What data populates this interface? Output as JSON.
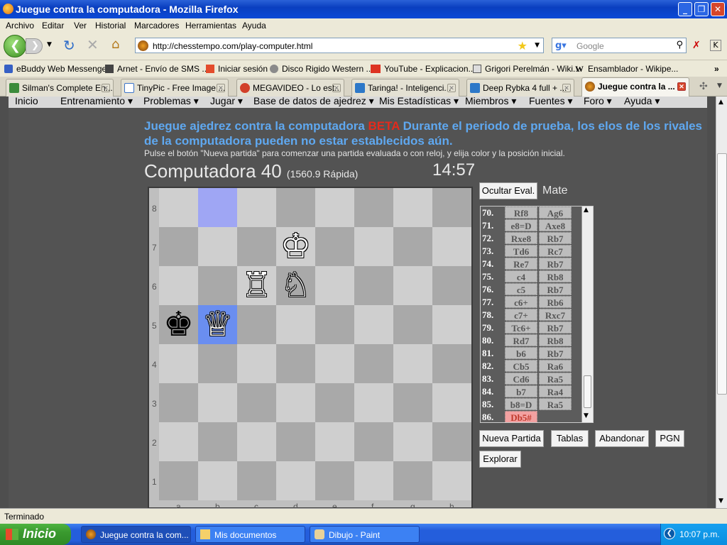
{
  "window": {
    "title": "Juegue contra la computadora - Mozilla Firefox"
  },
  "menu": [
    "Archivo",
    "Editar",
    "Ver",
    "Historial",
    "Marcadores",
    "Herramientas",
    "Ayuda"
  ],
  "nav": {
    "url": "http://chesstempo.com/play-computer.html",
    "search_placeholder": "Google"
  },
  "bookmarks": [
    "eBuddy Web Messenger",
    "Arnet - Envío de SMS ...",
    "Iniciar sesión",
    "Disco Rigido Western ...",
    "YouTube - Explicacion...",
    "Grigori Perelmán - Wiki...",
    "Ensamblador - Wikipe..."
  ],
  "tabs": [
    {
      "label": "Silman's Complete En...",
      "active": false
    },
    {
      "label": "TinyPic - Free Image ...",
      "active": false
    },
    {
      "label": "MEGAVIDEO - Lo est...",
      "active": false
    },
    {
      "label": "Taringa! - Inteligenci...",
      "active": false
    },
    {
      "label": "Deep Rybka 4 full + ...",
      "active": false
    },
    {
      "label": "Juegue contra la ...",
      "active": true
    }
  ],
  "sitenav": [
    "Inicio",
    "Entrenamiento ▾",
    "Problemas ▾",
    "Jugar ▾",
    "Base de datos de ajedrez ▾",
    "Mis Estadísticas ▾",
    "Miembros ▾",
    "Fuentes ▾",
    "Foro ▾",
    "Ayuda ▾"
  ],
  "page": {
    "heading_pre": "Juegue ajedrez contra la computadora ",
    "heading_beta": "BETA",
    "heading_post": " Durante el periodo de prueba, los elos de los rivales",
    "heading_line2": "de la computadora pueden no estar establecidos aún.",
    "subtitle": "Pulse el botón \"Nueva partida\" para comenzar una partida evaluada o con reloj, y elija color y la posición inicial.",
    "opponent_name": "Computadora 40",
    "opponent_rating": "(1560.9 Rápida)",
    "clock": "14:57"
  },
  "board": {
    "ranks": [
      "8",
      "7",
      "6",
      "5",
      "4",
      "3",
      "2",
      "1"
    ],
    "files": [
      "a",
      "b",
      "c",
      "d",
      "e",
      "f",
      "g",
      "h"
    ],
    "highlight_squares": [
      "b8",
      "b5"
    ],
    "pieces": [
      {
        "square": "d7",
        "glyph": "♔",
        "color": "white",
        "name": "white-king"
      },
      {
        "square": "c6",
        "glyph": "♖",
        "color": "white",
        "name": "white-rook"
      },
      {
        "square": "d6",
        "glyph": "♘",
        "color": "white",
        "name": "white-knight"
      },
      {
        "square": "a5",
        "glyph": "♚",
        "color": "black",
        "name": "black-king"
      },
      {
        "square": "b5",
        "glyph": "♕",
        "color": "white",
        "name": "white-queen"
      }
    ]
  },
  "controls": {
    "hide_eval": "Ocultar Eval.",
    "eval_text": "Mate",
    "new_game": "Nueva Partida",
    "draw": "Tablas",
    "resign": "Abandonar",
    "pgn": "PGN",
    "explore": "Explorar"
  },
  "moves": [
    {
      "n": "70.",
      "w": "Rf8",
      "b": "Ag6"
    },
    {
      "n": "71.",
      "w": "e8=D",
      "b": "Axe8"
    },
    {
      "n": "72.",
      "w": "Rxe8",
      "b": "Rb7"
    },
    {
      "n": "73.",
      "w": "Td6",
      "b": "Rc7"
    },
    {
      "n": "74.",
      "w": "Re7",
      "b": "Rb7"
    },
    {
      "n": "75.",
      "w": "c4",
      "b": "Rb8"
    },
    {
      "n": "76.",
      "w": "c5",
      "b": "Rb7"
    },
    {
      "n": "77.",
      "w": "c6+",
      "b": "Rb6"
    },
    {
      "n": "78.",
      "w": "c7+",
      "b": "Rxc7"
    },
    {
      "n": "79.",
      "w": "Tc6+",
      "b": "Rb7"
    },
    {
      "n": "80.",
      "w": "Rd7",
      "b": "Rb8"
    },
    {
      "n": "81.",
      "w": "b6",
      "b": "Rb7"
    },
    {
      "n": "82.",
      "w": "Cb5",
      "b": "Ra6"
    },
    {
      "n": "83.",
      "w": "Cd6",
      "b": "Ra5"
    },
    {
      "n": "84.",
      "w": "b7",
      "b": "Ra4"
    },
    {
      "n": "85.",
      "w": "b8=D",
      "b": "Ra5"
    },
    {
      "n": "86.",
      "w": "Db5#",
      "b": ""
    }
  ],
  "status": "Terminado",
  "taskbar": {
    "start": "Inicio",
    "tasks": [
      "Juegue contra la com...",
      "Mis documentos",
      "Dibujo - Paint"
    ],
    "clock": "10:07 p.m."
  }
}
